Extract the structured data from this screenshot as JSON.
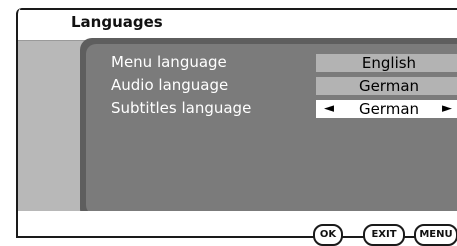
{
  "title": "Languages",
  "settings": [
    {
      "label": "Menu language",
      "value": "English"
    },
    {
      "label": "Audio language",
      "value": "German"
    },
    {
      "label": "Subtitles language",
      "value": "German"
    }
  ],
  "arrows": {
    "left": "◄",
    "right": "►"
  },
  "buttons": {
    "ok": "OK",
    "exit": "EXIT",
    "menu": "MENU"
  }
}
